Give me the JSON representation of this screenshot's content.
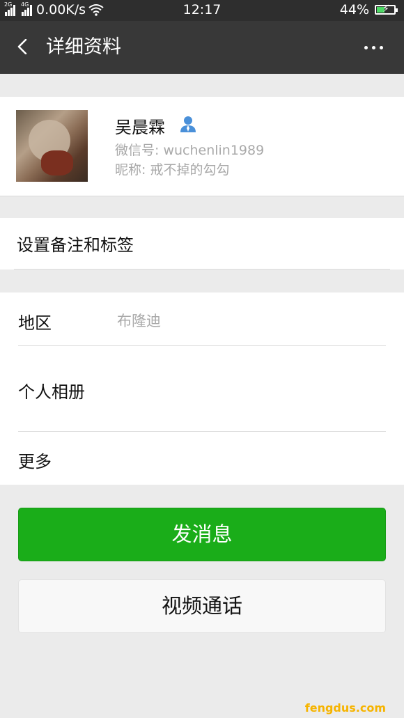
{
  "status_bar": {
    "net_2g": "2G",
    "net_4g": "4G",
    "speed": "0.00K/s",
    "time": "12:17",
    "battery_pct": "44%",
    "battery_level": 0.44
  },
  "nav": {
    "title": "详细资料"
  },
  "profile": {
    "name": "吴晨霖",
    "wechat_id": "微信号: wuchenlin1989",
    "nickname": "昵称: 戒不掉的勾勾"
  },
  "remark": {
    "label": "设置备注和标签"
  },
  "info": {
    "region_label": "地区",
    "region_value": "布隆迪",
    "album_label": "个人相册",
    "more_label": "更多"
  },
  "actions": {
    "message": "发消息",
    "video_call": "视频通话"
  },
  "watermark": "fengdus.com",
  "colors": {
    "primary_green": "#1aad19",
    "nav_bg": "#383838",
    "contact_icon": "#4a90d9"
  },
  "icons": {
    "back": "chevron-left-icon",
    "more": "more-dots-icon",
    "contact": "contact-person-icon",
    "wifi": "wifi-icon",
    "signal": "signal-icon",
    "battery": "battery-icon"
  }
}
